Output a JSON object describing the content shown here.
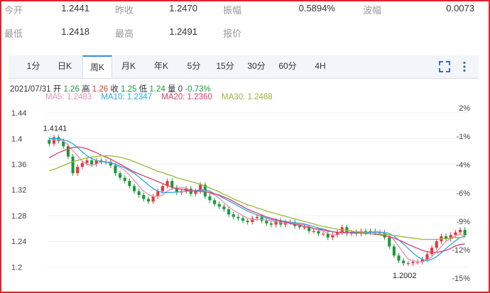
{
  "quote": {
    "open_label": "今开",
    "open_value": "1.2441",
    "prev_close_label": "昨收",
    "prev_close_value": "1.2470",
    "amplitude_label": "振幅",
    "amplitude_value": "0.5894%",
    "volatility_label": "波幅",
    "volatility_value": "0.0073",
    "low_label": "最低",
    "low_value": "1.2418",
    "high_label": "最高",
    "high_value": "1.2491",
    "quote_label": "报价",
    "quote_value": ""
  },
  "tabs": [
    {
      "label": "1分"
    },
    {
      "label": "日K"
    },
    {
      "label": "周K"
    },
    {
      "label": "月K"
    },
    {
      "label": "年K"
    },
    {
      "label": "5分"
    },
    {
      "label": "15分"
    },
    {
      "label": "30分"
    },
    {
      "label": "60分"
    },
    {
      "label": "4H"
    }
  ],
  "active_tab_index": 2,
  "toolbar": {
    "fullscreen_icon": "fullscreen-icon",
    "more_icon": "more-vertical-icon"
  },
  "info": {
    "date": "2021/07/31",
    "open_label": "开",
    "open": "1.26",
    "high_label": "高",
    "high": "1.26",
    "close_label": "收",
    "close": "1.25",
    "low_label": "低",
    "low": "1.24",
    "volume_label": "量",
    "volume": "0",
    "change": "-0.73%"
  },
  "ma_legend": [
    {
      "label": "MA5: 1.2483",
      "color": "#f08cb4"
    },
    {
      "label": "MA10: 1.2347",
      "color": "#27a9e1"
    },
    {
      "label": "MA20: 1.2360",
      "color": "#d93b6e"
    },
    {
      "label": "MA30: 1.2468",
      "color": "#9ab83a"
    }
  ],
  "colors": {
    "up": "#e23a3a",
    "down": "#1a9a3a",
    "accent": "#3b8be8",
    "border": "#e0242c"
  },
  "chart_data": {
    "type": "candlestick",
    "y_ticks": [
      "1.44",
      "1.4",
      "1.36",
      "1.32",
      "1.28",
      "1.24",
      "1.2"
    ],
    "y_right_ticks": [
      "2%",
      "-1%",
      "-4%",
      "-6%",
      "-9%",
      "-12%",
      "-15%"
    ],
    "ylim": [
      1.185,
      1.45
    ],
    "annotations": [
      {
        "label": "1.4141",
        "index": 2
      },
      {
        "label": "1.2002",
        "index": 76
      }
    ],
    "close": [
      1.392,
      1.402,
      1.396,
      1.388,
      1.372,
      1.346,
      1.356,
      1.362,
      1.366,
      1.36,
      1.366,
      1.364,
      1.364,
      1.358,
      1.346,
      1.339,
      1.334,
      1.326,
      1.318,
      1.312,
      1.306,
      1.302,
      1.31,
      1.318,
      1.326,
      1.334,
      1.324,
      1.316,
      1.318,
      1.322,
      1.314,
      1.318,
      1.328,
      1.31,
      1.304,
      1.298,
      1.294,
      1.29,
      1.282,
      1.278,
      1.276,
      1.272,
      1.27,
      1.276,
      1.278,
      1.272,
      1.268,
      1.266,
      1.272,
      1.266,
      1.27,
      1.27,
      1.264,
      1.262,
      1.262,
      1.256,
      1.256,
      1.252,
      1.252,
      1.246,
      1.25,
      1.254,
      1.262,
      1.252,
      1.254,
      1.252,
      1.256,
      1.254,
      1.256,
      1.254,
      1.254,
      1.246,
      1.232,
      1.218,
      1.21,
      1.206,
      1.206,
      1.208,
      1.208,
      1.212,
      1.22,
      1.23,
      1.24,
      1.248,
      1.244,
      1.25,
      1.254,
      1.258,
      1.25
    ],
    "open": [
      1.398,
      1.392,
      1.402,
      1.396,
      1.388,
      1.372,
      1.346,
      1.356,
      1.362,
      1.366,
      1.36,
      1.366,
      1.364,
      1.364,
      1.358,
      1.346,
      1.339,
      1.334,
      1.326,
      1.318,
      1.312,
      1.306,
      1.302,
      1.31,
      1.318,
      1.326,
      1.334,
      1.324,
      1.316,
      1.318,
      1.322,
      1.314,
      1.318,
      1.328,
      1.31,
      1.304,
      1.298,
      1.294,
      1.29,
      1.282,
      1.278,
      1.276,
      1.272,
      1.27,
      1.276,
      1.278,
      1.272,
      1.268,
      1.266,
      1.272,
      1.266,
      1.27,
      1.27,
      1.264,
      1.262,
      1.262,
      1.256,
      1.256,
      1.252,
      1.252,
      1.246,
      1.25,
      1.254,
      1.262,
      1.252,
      1.254,
      1.252,
      1.256,
      1.254,
      1.256,
      1.254,
      1.254,
      1.246,
      1.232,
      1.218,
      1.21,
      1.206,
      1.206,
      1.208,
      1.208,
      1.212,
      1.22,
      1.23,
      1.24,
      1.248,
      1.244,
      1.25,
      1.254,
      1.258
    ],
    "series": [
      {
        "name": "MA5",
        "values": [
          1.398,
          1.398,
          1.398,
          1.396,
          1.39,
          1.381,
          1.373,
          1.365,
          1.36,
          1.358,
          1.36,
          1.364,
          1.364,
          1.363,
          1.36,
          1.355,
          1.35,
          1.343,
          1.335,
          1.326,
          1.318,
          1.313,
          1.31,
          1.31,
          1.312,
          1.318,
          1.322,
          1.323,
          1.324,
          1.323,
          1.319,
          1.318,
          1.32,
          1.318,
          1.315,
          1.312,
          1.307,
          1.3,
          1.294,
          1.288,
          1.284,
          1.28,
          1.276,
          1.274,
          1.274,
          1.274,
          1.273,
          1.272,
          1.271,
          1.269,
          1.268,
          1.269,
          1.268,
          1.266,
          1.266,
          1.263,
          1.26,
          1.258,
          1.256,
          1.252,
          1.25,
          1.25,
          1.253,
          1.253,
          1.254,
          1.255,
          1.255,
          1.254,
          1.254,
          1.255,
          1.255,
          1.253,
          1.249,
          1.242,
          1.232,
          1.222,
          1.212,
          1.21,
          1.208,
          1.208,
          1.211,
          1.216,
          1.224,
          1.232,
          1.24,
          1.245,
          1.249,
          1.251,
          1.248
        ]
      },
      {
        "name": "MA10",
        "values": [
          1.4,
          1.4,
          1.4,
          1.398,
          1.396,
          1.392,
          1.386,
          1.379,
          1.373,
          1.369,
          1.366,
          1.364,
          1.363,
          1.362,
          1.36,
          1.357,
          1.354,
          1.35,
          1.346,
          1.34,
          1.334,
          1.328,
          1.322,
          1.318,
          1.316,
          1.316,
          1.316,
          1.317,
          1.317,
          1.318,
          1.318,
          1.319,
          1.32,
          1.32,
          1.318,
          1.314,
          1.311,
          1.307,
          1.303,
          1.299,
          1.295,
          1.291,
          1.287,
          1.284,
          1.281,
          1.279,
          1.276,
          1.274,
          1.273,
          1.272,
          1.271,
          1.27,
          1.269,
          1.268,
          1.267,
          1.265,
          1.263,
          1.261,
          1.259,
          1.257,
          1.255,
          1.254,
          1.254,
          1.254,
          1.254,
          1.254,
          1.254,
          1.254,
          1.254,
          1.254,
          1.254,
          1.254,
          1.252,
          1.248,
          1.242,
          1.236,
          1.229,
          1.222,
          1.216,
          1.212,
          1.21,
          1.212,
          1.216,
          1.222,
          1.229,
          1.235,
          1.241,
          1.246,
          1.248
        ]
      },
      {
        "name": "MA20",
        "values": [
          1.37,
          1.374,
          1.378,
          1.381,
          1.384,
          1.386,
          1.387,
          1.386,
          1.384,
          1.381,
          1.378,
          1.374,
          1.371,
          1.368,
          1.364,
          1.36,
          1.356,
          1.352,
          1.348,
          1.345,
          1.342,
          1.339,
          1.336,
          1.333,
          1.33,
          1.327,
          1.324,
          1.322,
          1.321,
          1.32,
          1.319,
          1.318,
          1.318,
          1.317,
          1.316,
          1.314,
          1.312,
          1.309,
          1.306,
          1.302,
          1.298,
          1.294,
          1.29,
          1.287,
          1.284,
          1.281,
          1.278,
          1.276,
          1.274,
          1.272,
          1.27,
          1.268,
          1.266,
          1.265,
          1.263,
          1.262,
          1.26,
          1.259,
          1.258,
          1.256,
          1.255,
          1.254,
          1.254,
          1.254,
          1.253,
          1.253,
          1.253,
          1.252,
          1.252,
          1.251,
          1.25,
          1.249,
          1.247,
          1.245,
          1.242,
          1.239,
          1.235,
          1.232,
          1.229,
          1.226,
          1.224,
          1.223,
          1.223,
          1.224,
          1.226,
          1.229,
          1.233,
          1.235,
          1.236
        ]
      },
      {
        "name": "MA30",
        "values": [
          1.35,
          1.352,
          1.355,
          1.358,
          1.361,
          1.364,
          1.366,
          1.368,
          1.37,
          1.371,
          1.372,
          1.373,
          1.373,
          1.373,
          1.372,
          1.371,
          1.369,
          1.367,
          1.364,
          1.361,
          1.358,
          1.355,
          1.352,
          1.349,
          1.347,
          1.344,
          1.342,
          1.339,
          1.337,
          1.335,
          1.333,
          1.331,
          1.329,
          1.326,
          1.323,
          1.32,
          1.317,
          1.313,
          1.31,
          1.306,
          1.303,
          1.3,
          1.297,
          1.295,
          1.292,
          1.29,
          1.287,
          1.285,
          1.283,
          1.281,
          1.279,
          1.277,
          1.275,
          1.273,
          1.271,
          1.269,
          1.267,
          1.265,
          1.263,
          1.262,
          1.26,
          1.259,
          1.258,
          1.257,
          1.256,
          1.255,
          1.254,
          1.253,
          1.252,
          1.252,
          1.251,
          1.251,
          1.25,
          1.249,
          1.248,
          1.247,
          1.246,
          1.245,
          1.244,
          1.243,
          1.243,
          1.243,
          1.243,
          1.244,
          1.244,
          1.245,
          1.246,
          1.246,
          1.247
        ]
      }
    ]
  }
}
